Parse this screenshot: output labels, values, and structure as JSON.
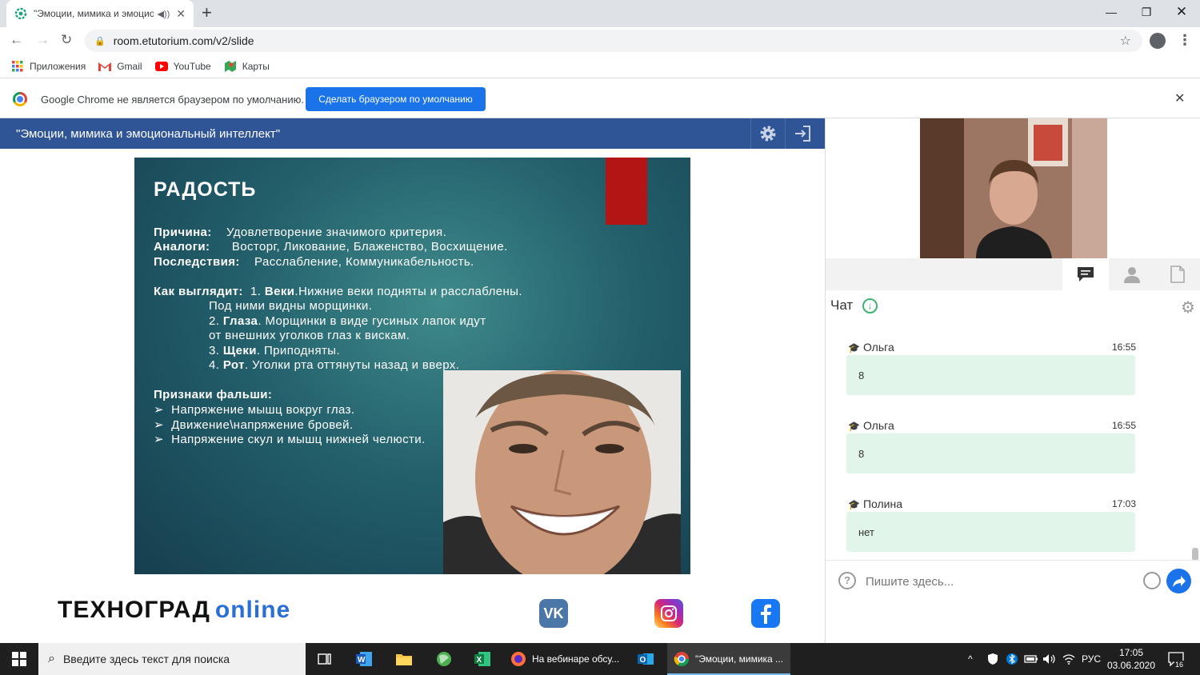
{
  "browser": {
    "tab_title": "\"Эмоции, мимика и эмоциональный интеллект\"",
    "url": "room.etutorium.com/v2/slide",
    "bookmarks": [
      {
        "label": "Приложения",
        "icon": "apps-grid-icon"
      },
      {
        "label": "Gmail",
        "icon": "gmail-icon"
      },
      {
        "label": "YouTube",
        "icon": "youtube-icon"
      },
      {
        "label": "Карты",
        "icon": "maps-icon"
      }
    ],
    "infobar": {
      "message": "Google Chrome не является браузером по умолчанию.",
      "button": "Сделать браузером по умолчанию"
    }
  },
  "webinar": {
    "title": "\"Эмоции, мимика и эмоциональный интеллект\""
  },
  "slide": {
    "heading": "РАДОСТЬ",
    "cause_label": "Причина:",
    "cause": "Удовлетворение значимого критерия.",
    "analogs_label": "Аналоги:",
    "analogs": "Восторг, Ликование, Блаженство, Восхищение.",
    "effects_label": "Последствия:",
    "effects": "Расслабление, Коммуникабельность.",
    "look_label": "Как выглядит:",
    "look_1_num": "1.",
    "look_1_bold": "Веки",
    "look_1_text": ".Нижние веки подняты и расслаблены.",
    "look_1_cont": "Под ними видны морщинки.",
    "look_2_num": "2.",
    "look_2_bold": "Глаза",
    "look_2_text": ". Морщинки в виде гусиных лапок идут",
    "look_2_cont": "от внешних уголков глаз к вискам.",
    "look_3_num": "3.",
    "look_3_bold": "Щеки",
    "look_3_text": ". Приподняты.",
    "look_4_num": "4.",
    "look_4_bold": "Рот",
    "look_4_text": ". Уголки рта оттянуты назад и вверх.",
    "fake_label": "Признаки фальши:",
    "fake_items": [
      "Напряжение мышц вокруг глаз.",
      "Движение\\напряжение бровей.",
      "Напряжение скул и мышц нижней челюсти."
    ]
  },
  "footer": {
    "logo_main": "ТЕХНОГРАД",
    "logo_suffix": "online",
    "social_vk": "VK",
    "colors": {
      "vk": "#4a76a8",
      "facebook": "#1877f2"
    }
  },
  "chat": {
    "label": "Чат",
    "messages": [
      {
        "author": "Ольга",
        "time": "16:55",
        "text": "8"
      },
      {
        "author": "Ольга",
        "time": "16:55",
        "text": "8"
      },
      {
        "author": "Полина",
        "time": "17:03",
        "text": "нет"
      }
    ],
    "input_placeholder": "Пишите здесь..."
  },
  "taskbar": {
    "search_placeholder": "Введите здесь текст для поиска",
    "apps": [
      {
        "label": "На вебинаре обсу...",
        "icon": "firefox-icon"
      },
      {
        "label": "\"Эмоции, мимика ...",
        "icon": "chrome-icon"
      }
    ],
    "tray": {
      "language": "РУС",
      "time": "17:05",
      "date": "03.06.2020",
      "notification_count": "16"
    }
  }
}
